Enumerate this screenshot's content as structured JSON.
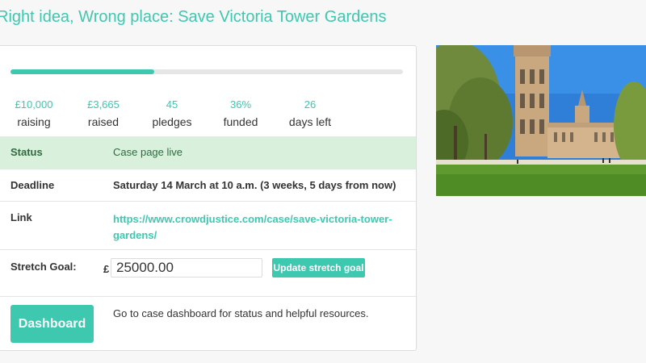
{
  "case": {
    "title": "Right idea, Wrong place: Save Victoria Tower Gardens"
  },
  "progress": {
    "funded_fraction": 0.366
  },
  "stats": [
    {
      "value": "£10,000",
      "label": "raising"
    },
    {
      "value": "£3,665",
      "label": "raised"
    },
    {
      "value": "45",
      "label": "pledges"
    },
    {
      "value": "36%",
      "label": "funded"
    },
    {
      "value": "26",
      "label": "days left"
    }
  ],
  "status": {
    "label": "Status",
    "value": "Case page live"
  },
  "deadline": {
    "label": "Deadline",
    "value": "Saturday 14 March at 10 a.m. (3 weeks, 5 days from now)"
  },
  "link": {
    "label": "Link",
    "url": "https://www.crowdjustice.com/case/save-victoria-tower-gardens/"
  },
  "stretch": {
    "label": "Stretch Goal:",
    "currency": "£",
    "value": "25000.00",
    "button_label": "Update stretch goal"
  },
  "dashboard": {
    "button_label": "Dashboard",
    "description": "Go to case dashboard for status and helpful resources."
  },
  "colors": {
    "accent": "#3ec8b0",
    "status_bg": "#d9f0dc",
    "status_text": "#2f6b3e"
  },
  "image": {
    "subject": "victoria-tower-gardens-photo"
  }
}
